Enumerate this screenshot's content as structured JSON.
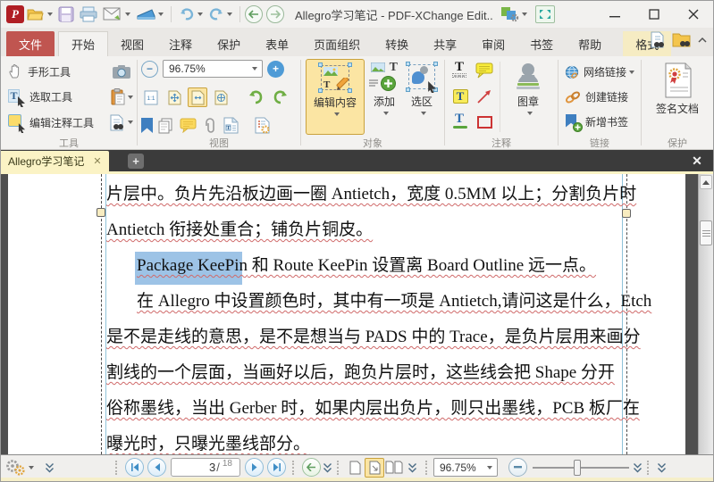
{
  "titlebar": {
    "title": "Allegro学习笔记 - PDF-XChange Edit.."
  },
  "ribbon_tabs": [
    {
      "label": "文件"
    },
    {
      "label": "开始"
    },
    {
      "label": "视图"
    },
    {
      "label": "注释"
    },
    {
      "label": "保护"
    },
    {
      "label": "表单"
    },
    {
      "label": "页面组织"
    },
    {
      "label": "转换"
    },
    {
      "label": "共享"
    },
    {
      "label": "审阅"
    },
    {
      "label": "书签"
    },
    {
      "label": "帮助"
    },
    {
      "label": "格式"
    }
  ],
  "ribbon": {
    "tools": {
      "label": "工具",
      "hand": "手形工具",
      "select": "选取工具",
      "edit_comment": "编辑注释工具"
    },
    "view": {
      "label": "视图",
      "zoom": "96.75%"
    },
    "objects": {
      "label": "对象",
      "edit": "编辑内容",
      "add": "添加",
      "select": "选区"
    },
    "comments": {
      "label": "注释",
      "stamp": "图章"
    },
    "links": {
      "label": "链接",
      "web": "网络链接",
      "create": "创建链接",
      "bookmark": "新增书签"
    },
    "protect": {
      "label": "保护",
      "sign": "签名文档"
    }
  },
  "doc_tab": {
    "title": "Allegro学习笔记"
  },
  "document": {
    "lines": [
      {
        "text": "片层中。负片先沿板边画一圈 Antietch，宽度 0.5MM 以上；分割负片时"
      },
      {
        "text": "Antietch 衔接处重合；铺负片铜皮。"
      },
      {
        "pre": "Package KeePin",
        "post": " 和 Route KeePin 设置离 Board Outline 远一点。"
      },
      {
        "text": "在 Allegro 中设置颜色时，其中有一项是 Antietch,请问这是什么，Etch"
      },
      {
        "text": "是不是走线的意思，是不是想当与 PADS 中的 Trace，是负片层用来画分"
      },
      {
        "text": "割线的一个层面，当画好以后，跑负片层时，这些线会把 Shape 分开"
      },
      {
        "text": "俗称墨线，当出 Gerber 时，如果内层出负片，则只出墨线，PCB 板厂在"
      },
      {
        "text": "曝光时，只曝光墨线部分。"
      }
    ],
    "highlight_color": "#9dc3e6"
  },
  "statusbar": {
    "page_current": "3",
    "page_total": "18",
    "zoom": "96.75%"
  },
  "colors": {
    "accent_red": "#c05550",
    "selected_yellow": "#fbe5a3",
    "tab_yellow": "#fbf3c5"
  }
}
